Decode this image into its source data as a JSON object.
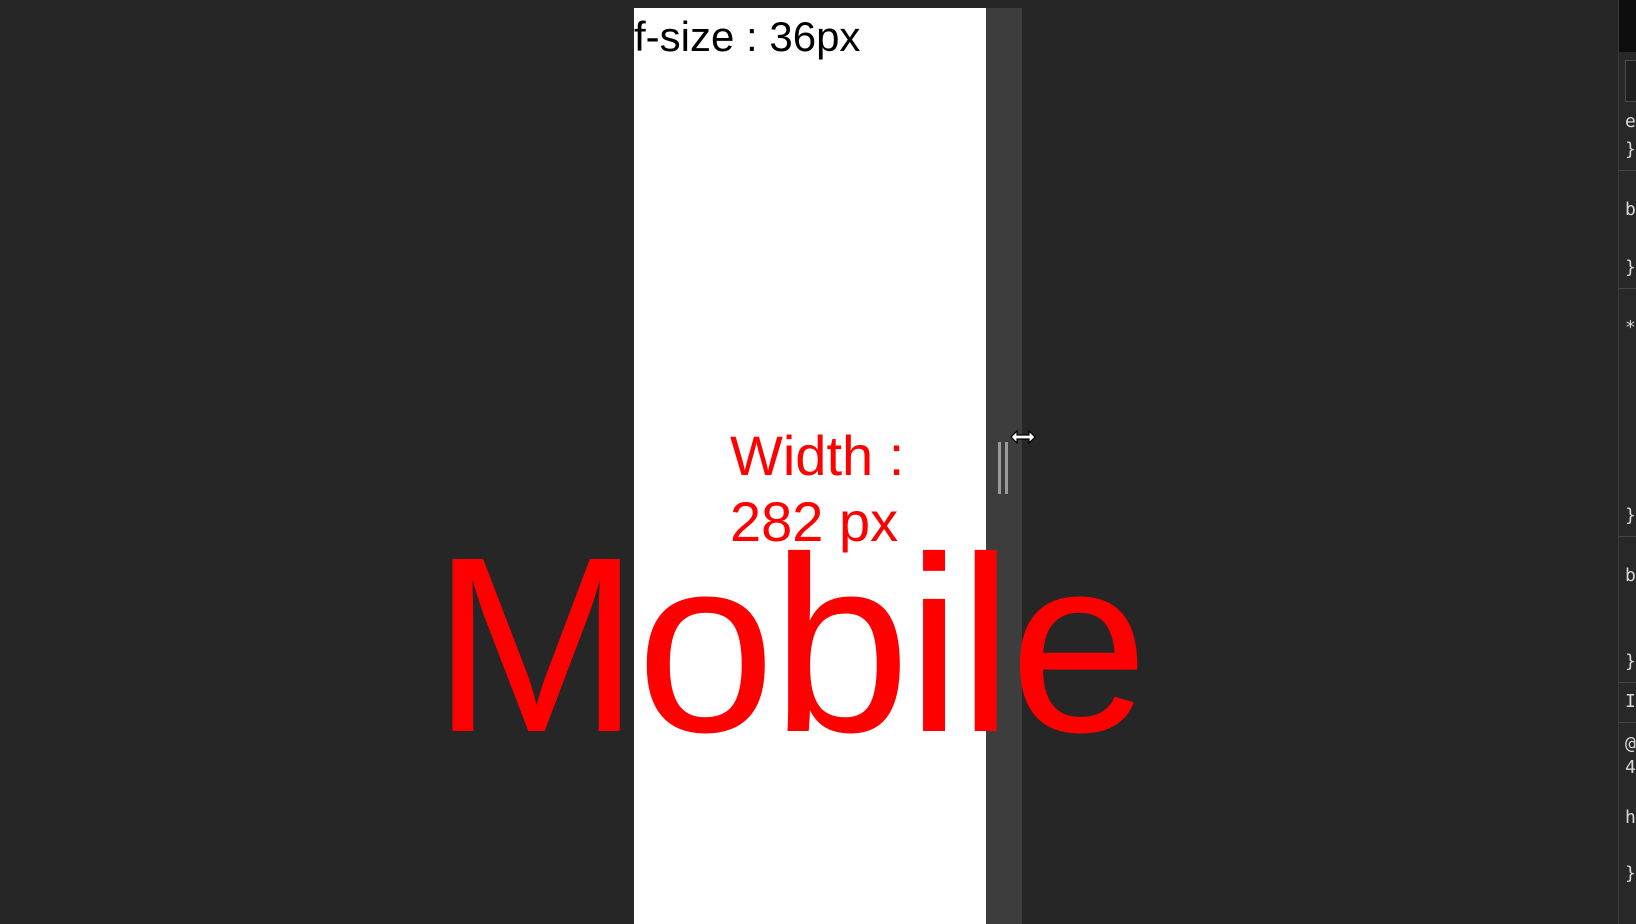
{
  "viewport": {
    "font_size_text": "f-size : 36px",
    "width_text_line1": "Width :",
    "width_text_line2": "282 px",
    "device_label": "Mobile"
  },
  "colors": {
    "background": "#262626",
    "viewport_bg": "#ffffff",
    "accent_text": "#ff0000",
    "gutter": "#3d3d3d"
  },
  "icons": {
    "resize_cursor": "horizontal-resize-cursor-icon",
    "resize_handle": "resize-handle-icon"
  },
  "devtools_fragments": [
    "e",
    "}",
    "b",
    "}",
    "*",
    "}",
    "b",
    "}",
    "I",
    "@",
    "4",
    "h",
    "}"
  ]
}
